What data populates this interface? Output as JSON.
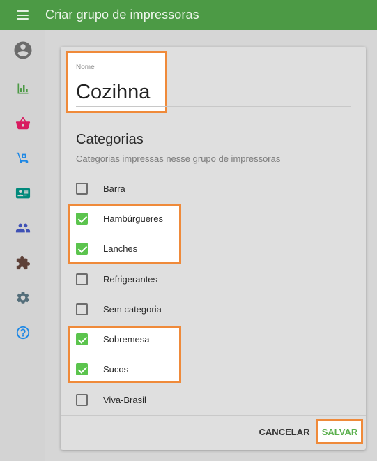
{
  "appbar": {
    "title": "Criar grupo de impressoras",
    "menu_icon": "menu-icon"
  },
  "sidebar": {
    "avatar_icon": "account-circle-icon",
    "items": [
      {
        "name": "bar-chart-icon",
        "color": "#4c9a45"
      },
      {
        "name": "basket-icon",
        "color": "#d81b60"
      },
      {
        "name": "hand-truck-icon",
        "color": "#1e88e5"
      },
      {
        "name": "contact-card-icon",
        "color": "#00897b"
      },
      {
        "name": "people-icon",
        "color": "#3f51b5"
      },
      {
        "name": "puzzle-icon",
        "color": "#5d4037"
      },
      {
        "name": "gear-icon",
        "color": "#546e7a"
      },
      {
        "name": "help-icon",
        "color": "#1e88e5"
      }
    ]
  },
  "form": {
    "name_label": "Nome",
    "name_value": "Cozihna",
    "categories_title": "Categorias",
    "categories_subtitle": "Categorias impressas nesse grupo de impressoras",
    "categories": [
      {
        "label": "Barra",
        "checked": false
      },
      {
        "label": "Hambúrgueres",
        "checked": true
      },
      {
        "label": "Lanches",
        "checked": true
      },
      {
        "label": "Refrigerantes",
        "checked": false
      },
      {
        "label": "Sem categoria",
        "checked": false
      },
      {
        "label": "Sobremesa",
        "checked": true
      },
      {
        "label": "Sucos",
        "checked": true
      },
      {
        "label": "Viva-Brasil",
        "checked": false
      }
    ]
  },
  "actions": {
    "cancel_label": "CANCELAR",
    "save_label": "SALVAR"
  },
  "colors": {
    "appbar": "#4c9a45",
    "accent": "#5bc44d",
    "highlight": "#ef8a3a"
  }
}
